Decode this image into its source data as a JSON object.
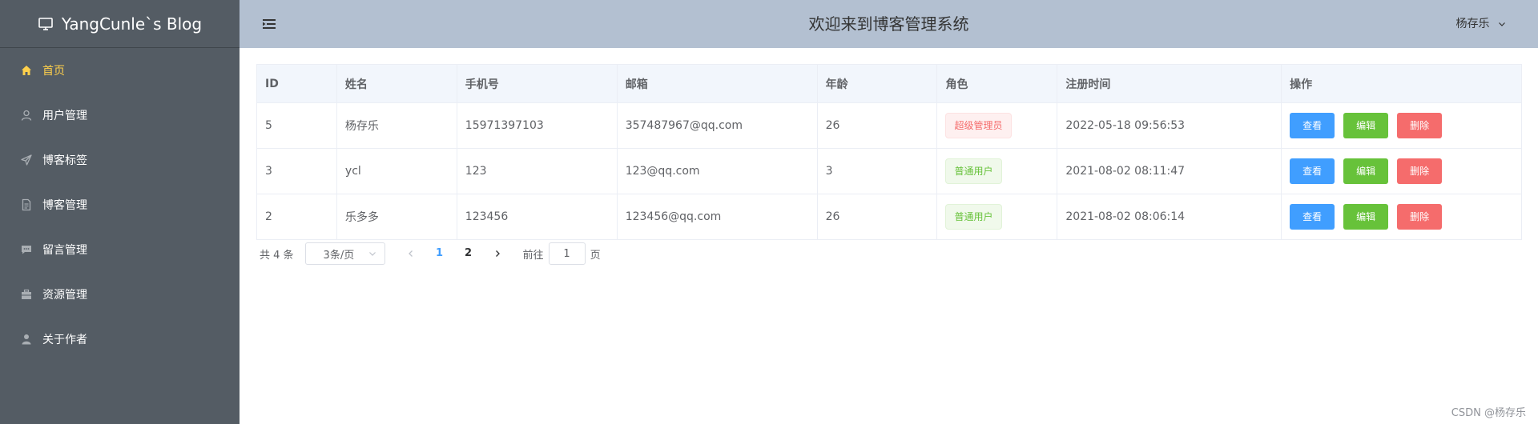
{
  "app": {
    "logo_text": "YangCunle`s Blog"
  },
  "sidebar": {
    "items": [
      {
        "label": "首页",
        "icon": "home-icon"
      },
      {
        "label": "用户管理",
        "icon": "user-icon"
      },
      {
        "label": "博客标签",
        "icon": "send-icon"
      },
      {
        "label": "博客管理",
        "icon": "document-icon"
      },
      {
        "label": "留言管理",
        "icon": "message-icon"
      },
      {
        "label": "资源管理",
        "icon": "box-icon"
      },
      {
        "label": "关于作者",
        "icon": "person-icon"
      }
    ],
    "active_index": 0
  },
  "header": {
    "title": "欢迎来到博客管理系统",
    "username": "杨存乐"
  },
  "table": {
    "columns": [
      "ID",
      "姓名",
      "手机号",
      "邮箱",
      "年龄",
      "角色",
      "注册时间",
      "操作"
    ],
    "rows": [
      {
        "id": "5",
        "name": "杨存乐",
        "phone": "15971397103",
        "email": "357487967@qq.com",
        "age": "26",
        "role": "超级管理员",
        "role_type": "danger",
        "registered": "2022-05-18 09:56:53"
      },
      {
        "id": "3",
        "name": "ycl",
        "phone": "123",
        "email": "123@qq.com",
        "age": "3",
        "role": "普通用户",
        "role_type": "success",
        "registered": "2021-08-02 08:11:47"
      },
      {
        "id": "2",
        "name": "乐多多",
        "phone": "123456",
        "email": "123456@qq.com",
        "age": "26",
        "role": "普通用户",
        "role_type": "success",
        "registered": "2021-08-02 08:06:14"
      }
    ],
    "actions": {
      "view": "查看",
      "edit": "编辑",
      "delete": "删除"
    }
  },
  "pagination": {
    "total_text": "共 4 条",
    "page_size_text": "3条/页",
    "pages": [
      "1",
      "2"
    ],
    "current_page": "1",
    "jump_label": "前往",
    "jump_value": "1",
    "jump_suffix": "页"
  },
  "watermark": "CSDN @杨存乐",
  "colors": {
    "sidebar_bg": "#545c64",
    "header_bg": "#b3c0d1",
    "active_menu": "#ffd04b",
    "primary": "#409eff",
    "success": "#67c23a",
    "danger": "#f56c6c"
  }
}
